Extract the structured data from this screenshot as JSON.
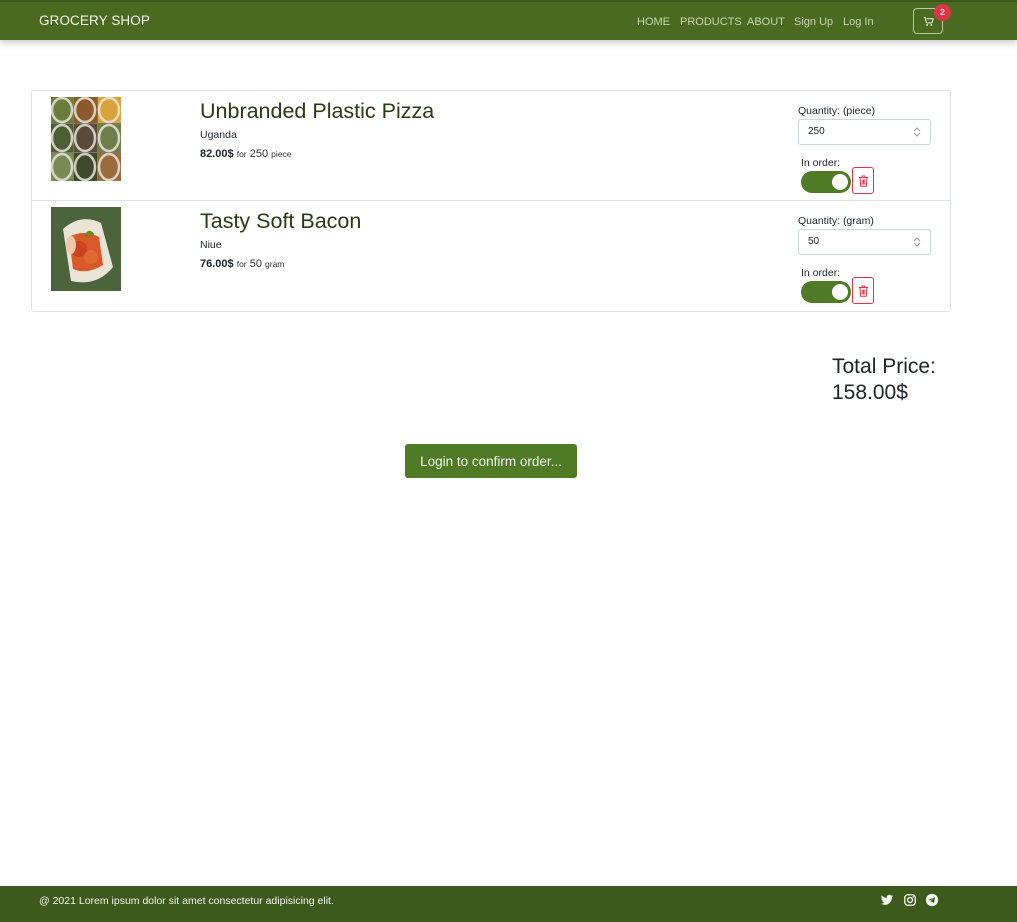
{
  "navbar": {
    "brand": "GROCERY SHOP",
    "links": [
      "HOME",
      "PRODUCTS",
      "ABOUT",
      "Sign Up",
      "Log In"
    ],
    "cart_count": "2",
    "background_color": "#4a6b1f"
  },
  "cart": {
    "items": [
      {
        "name": "Unbranded Plastic Pizza",
        "origin": "Uganda",
        "price": "82.00$",
        "for_text": "for",
        "amount": "250",
        "unit": "piece",
        "quantity_label": "Quantity: (piece)",
        "quantity_value": "250",
        "in_order_label": "In order:",
        "in_order": true,
        "image_icon": "spices-photo"
      },
      {
        "name": "Tasty Soft Bacon",
        "origin": "Niue",
        "price": "76.00$",
        "for_text": "for",
        "amount": "50",
        "unit": "gram",
        "quantity_label": "Quantity: (gram)",
        "quantity_value": "50",
        "in_order_label": "In order:",
        "in_order": true,
        "image_icon": "produce-bag-photo"
      }
    ]
  },
  "total": {
    "label": "Total Price:",
    "value": "158.00$"
  },
  "confirm_button": "Login to confirm order...",
  "footer": {
    "text": "@ 2021 Lorem ipsum dolor sit amet consectetur adipisicing elit.",
    "social_icons": [
      "twitter-icon",
      "instagram-icon",
      "telegram-icon"
    ]
  },
  "colors": {
    "accent": "#4f7a26",
    "danger": "#dc3545",
    "footer": "#3d5a1d"
  }
}
